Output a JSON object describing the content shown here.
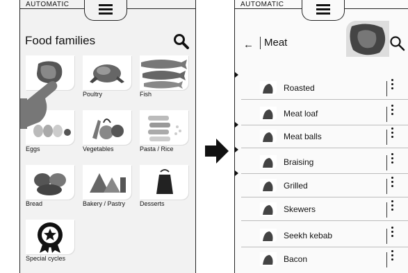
{
  "left_screen": {
    "mode_label": "AUTOMATIC",
    "title": "Food families",
    "tiles": [
      {
        "label": "",
        "icon": "meat-icon"
      },
      {
        "label": "Poultry",
        "icon": "poultry-icon"
      },
      {
        "label": "Fish",
        "icon": "fish-icon"
      },
      {
        "label": "Eggs",
        "icon": "eggs-icon"
      },
      {
        "label": "Vegetables",
        "icon": "vegetables-icon"
      },
      {
        "label": "Pasta / Rice",
        "icon": "pasta-icon"
      },
      {
        "label": "Bread",
        "icon": "bread-icon"
      },
      {
        "label": "Bakery / Pastry",
        "icon": "bakery-icon"
      },
      {
        "label": "Desserts",
        "icon": "desserts-icon"
      },
      {
        "label": "Special cycles",
        "icon": "special-cycles-icon"
      }
    ]
  },
  "right_screen": {
    "mode_label": "AUTOMATIC",
    "title": "Meat",
    "recipes": [
      {
        "label": "Roasted"
      },
      {
        "label": "Meat loaf"
      },
      {
        "label": "Meat balls"
      },
      {
        "label": "Braising"
      },
      {
        "label": "Grilled"
      },
      {
        "label": "Skewers"
      },
      {
        "label": "Seekh kebab"
      },
      {
        "label": "Bacon"
      }
    ]
  },
  "icons": {
    "search": "search-icon",
    "menu": "hamburger-menu-icon",
    "back": "back-arrow-icon",
    "more": "more-options-icon",
    "transition": "right-arrow-icon",
    "gesture": "hand-pointer-icon"
  }
}
